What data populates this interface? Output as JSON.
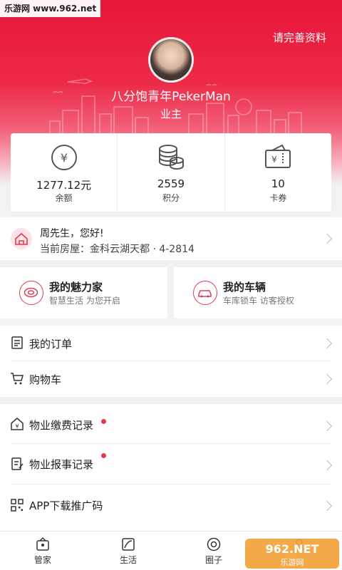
{
  "watermark": "乐游网 www.962.net",
  "header": {
    "complete_profile": "请完善资料",
    "username": "八分饱青年PekerMan",
    "role": "业主"
  },
  "stats": [
    {
      "value": "1277.12元",
      "label": "余额",
      "icon": "yen-coin-icon"
    },
    {
      "value": "2559",
      "label": "积分",
      "icon": "coin-stack-icon"
    },
    {
      "value": "10",
      "label": "卡券",
      "icon": "ticket-icon"
    }
  ],
  "house": {
    "greeting": "周先生，您好!",
    "address": "当前房屋：金科云湖天都 · 4-2814"
  },
  "features": [
    {
      "title": "我的魅力家",
      "subtitle": "智慧生活 为您开启"
    },
    {
      "title": "我的车辆",
      "subtitle": "车库锁车 访客授权"
    }
  ],
  "menu_group1": [
    {
      "label": "我的订单",
      "icon": "order-list-icon"
    },
    {
      "label": "购物车",
      "icon": "cart-icon"
    }
  ],
  "menu_group2": [
    {
      "label": "物业缴费记录",
      "icon": "house-yen-icon",
      "dot": true
    },
    {
      "label": "物业报事记录",
      "icon": "report-icon",
      "dot": true
    },
    {
      "label": "APP下载推广码",
      "icon": "qr-code-icon",
      "dot": false
    }
  ],
  "tabbar": [
    {
      "label": "管家",
      "icon": "butler-icon"
    },
    {
      "label": "生活",
      "icon": "life-icon"
    },
    {
      "label": "圈子",
      "icon": "circle-icon"
    },
    {
      "label": "",
      "icon": "me-icon"
    }
  ],
  "brand_badge": "962.NET 乐游网",
  "colors": {
    "accent": "#e8163a",
    "dot": "#e8374f"
  }
}
